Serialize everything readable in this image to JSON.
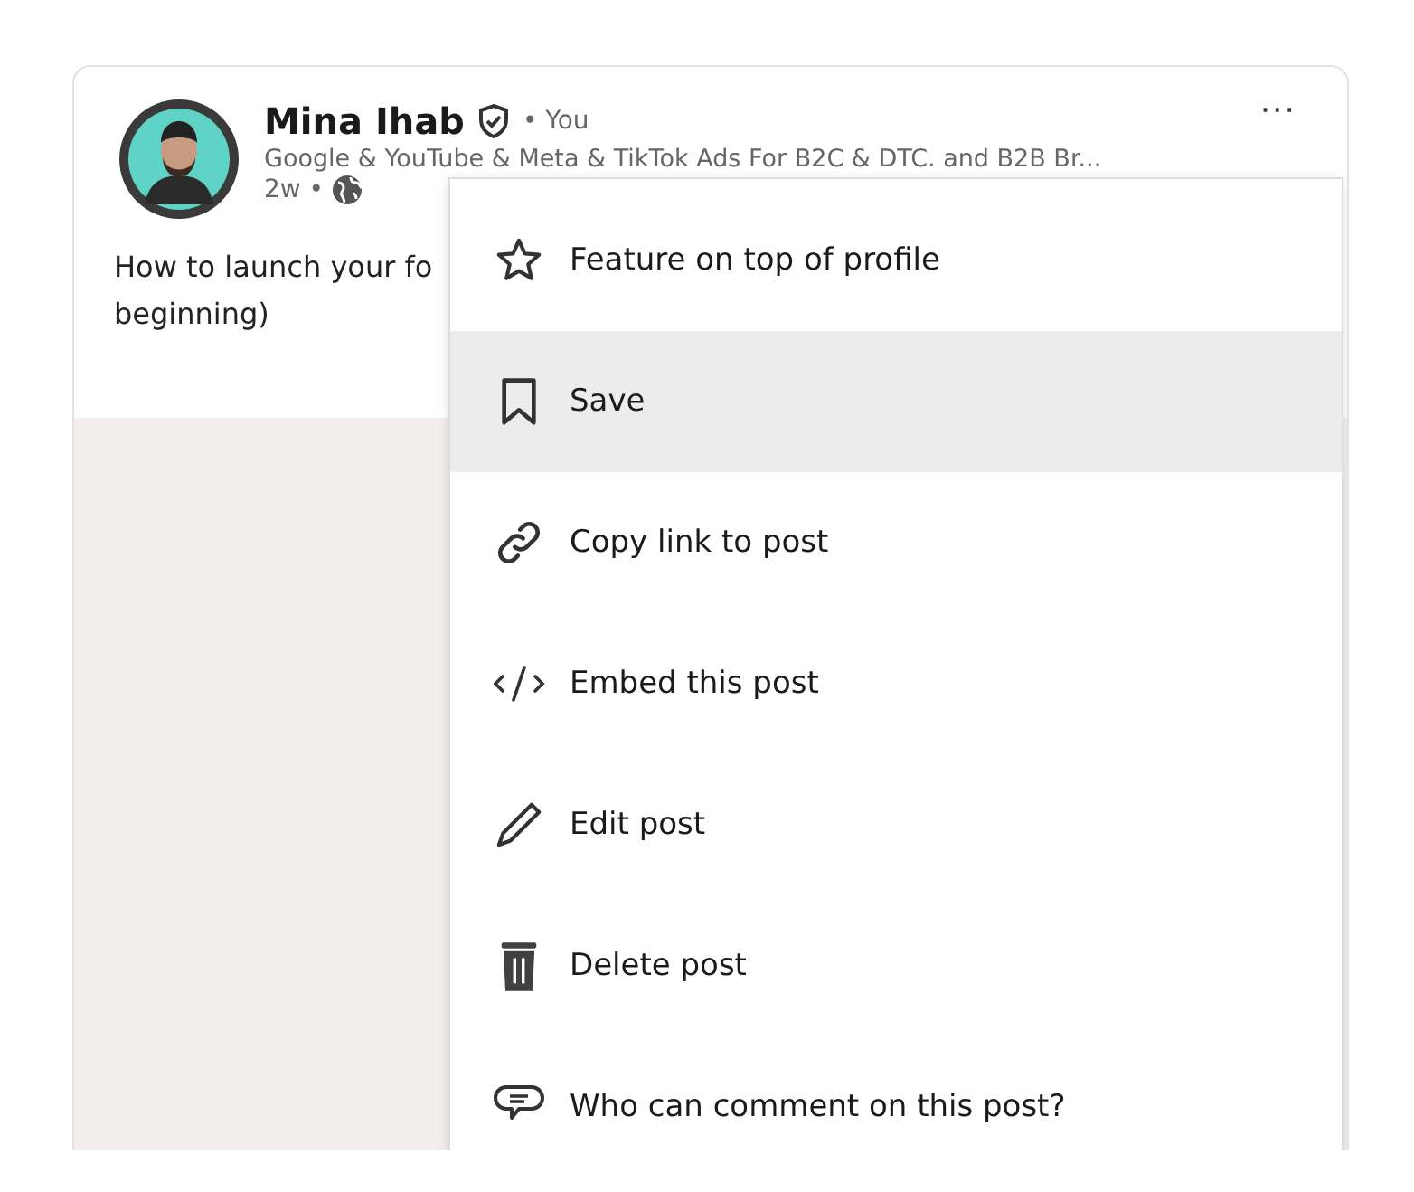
{
  "post": {
    "author": "Mina Ihab",
    "relation": "• You",
    "headline": "Google & YouTube & Meta & TikTok Ads For B2C & DTC. and B2B Br...",
    "age": "2w •",
    "more": "···",
    "text_lines": [
      "How to launch your fo",
      "beginning)"
    ],
    "media": {
      "kind": "placeholder"
    }
  },
  "menu": {
    "items": [
      {
        "kind": "star",
        "label": "Feature on top of profile",
        "selected": false
      },
      {
        "kind": "bookmark",
        "label": "Save",
        "selected": true
      },
      {
        "kind": "link",
        "label": "Copy link to post",
        "selected": false
      },
      {
        "kind": "code",
        "label": "Embed this post",
        "selected": false
      },
      {
        "kind": "pencil",
        "label": "Edit post",
        "selected": false
      },
      {
        "kind": "trash",
        "label": "Delete post",
        "selected": false
      },
      {
        "kind": "comment",
        "label": "Who can comment on this post?",
        "selected": false
      }
    ]
  }
}
